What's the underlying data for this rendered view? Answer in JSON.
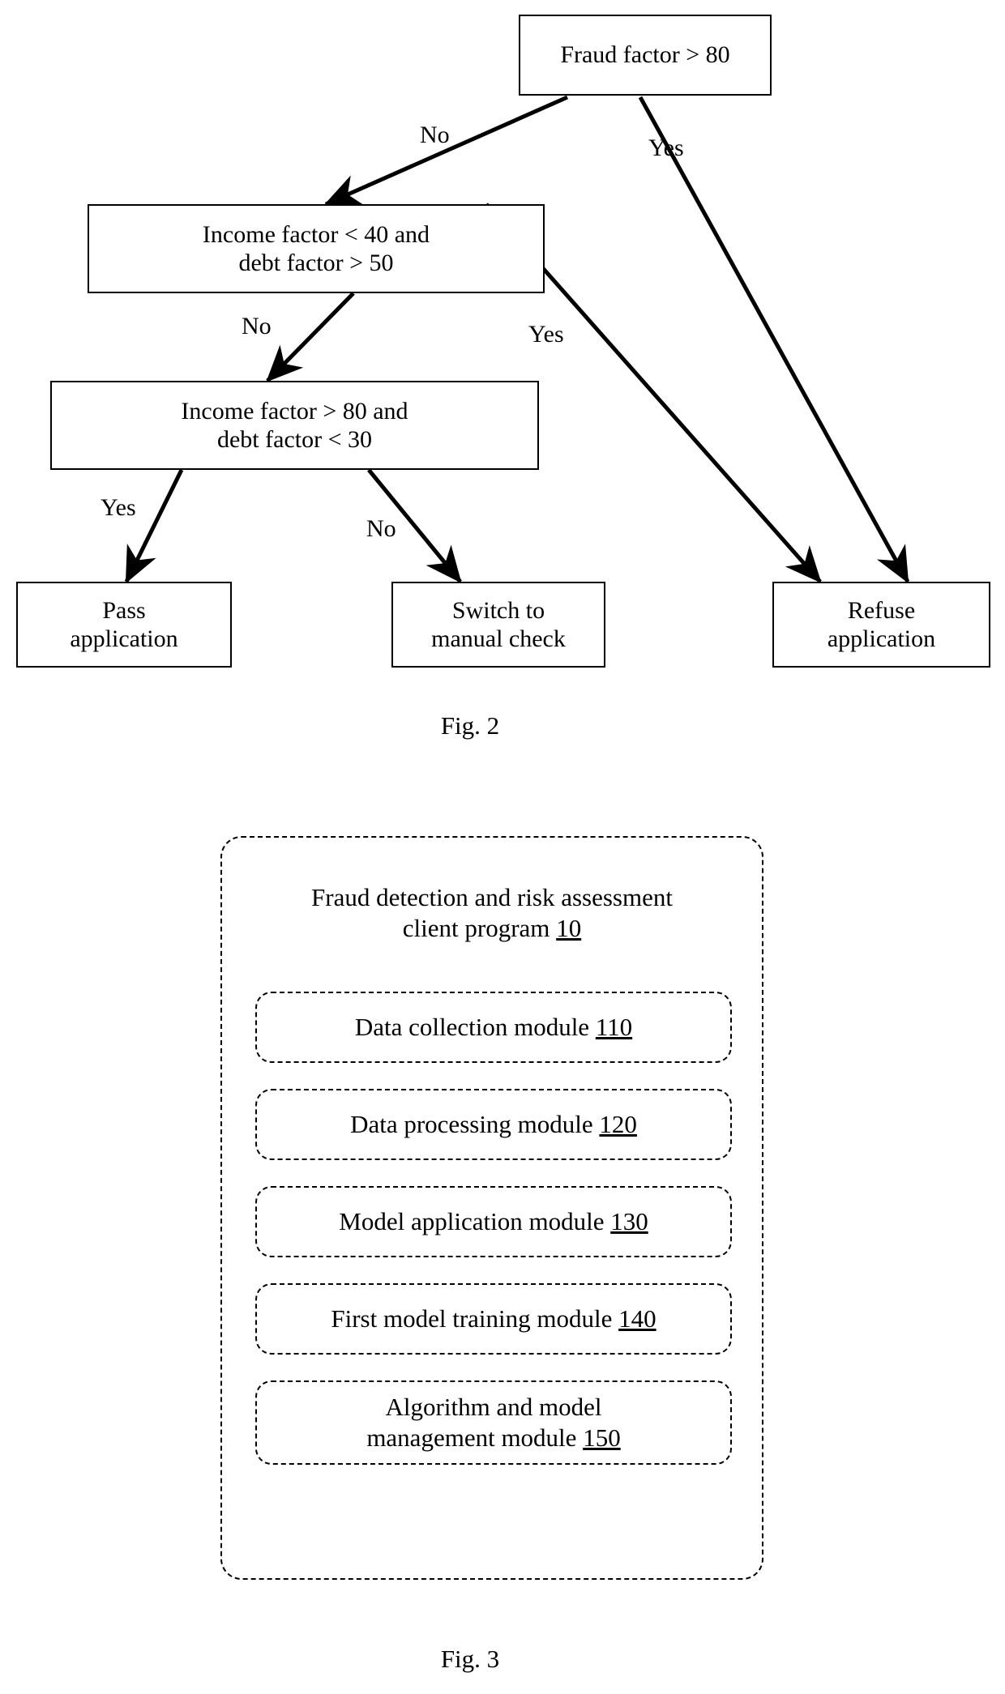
{
  "figure2": {
    "caption": "Fig. 2",
    "nodes": {
      "root": {
        "text": "Fraud factor > 80"
      },
      "decision2_line1": "Income factor < 40 and",
      "decision2_line2": "debt factor > 50",
      "decision3_line1": "Income factor > 80 and",
      "decision3_line2": "debt factor < 30",
      "pass_line1": "Pass",
      "pass_line2": "application",
      "manual_line1": "Switch to",
      "manual_line2": "manual check",
      "refuse_line1": "Refuse",
      "refuse_line2": "application"
    },
    "edge_labels": {
      "root_no": "No",
      "root_yes": "Yes",
      "d2_no": "No",
      "d2_yes": "Yes",
      "d3_yes": "Yes",
      "d3_no": "No"
    }
  },
  "figure3": {
    "caption": "Fig. 3",
    "title_line1": "Fraud detection and risk assessment",
    "title_line2_text": "client program ",
    "title_line2_ref": "10",
    "modules": [
      {
        "label": "Data collection module ",
        "ref": "110"
      },
      {
        "label": "Data processing module ",
        "ref": "120"
      },
      {
        "label": "Model application module ",
        "ref": "130"
      },
      {
        "label": "First model training module ",
        "ref": "140"
      },
      {
        "label_line1": "Algorithm and model",
        "label": "management module ",
        "ref": "150"
      }
    ]
  },
  "colors": {
    "ink": "#000000",
    "paper": "#ffffff"
  }
}
